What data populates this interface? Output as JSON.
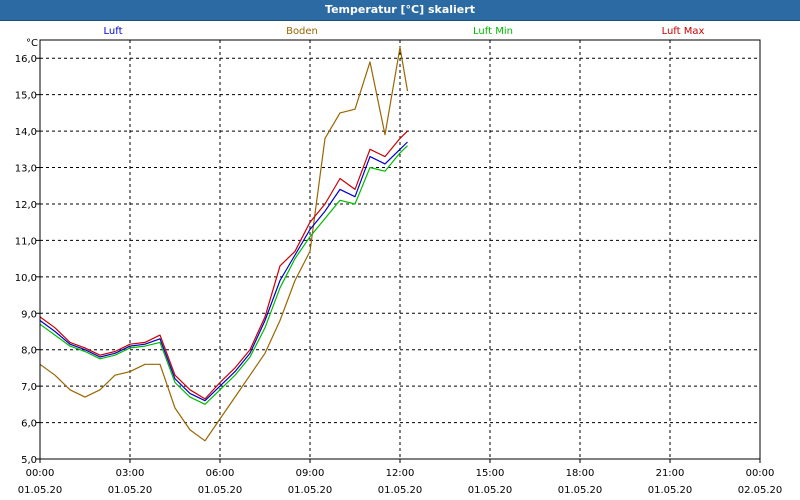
{
  "window": {
    "title": "Temperatur [°C] skaliert"
  },
  "chart_data": {
    "type": "line",
    "title": "Temperatur [°C] skaliert",
    "ylabel": "°C",
    "xlabel": "",
    "ylim": [
      5.0,
      16.5
    ],
    "y_ticks": [
      "5,0",
      "6,0",
      "7,0",
      "8,0",
      "9,0",
      "10,0",
      "11,0",
      "12,0",
      "13,0",
      "14,0",
      "15,0",
      "16,0"
    ],
    "x_ticks": [
      {
        "time": "00:00",
        "date": "01.05.20"
      },
      {
        "time": "03:00",
        "date": "01.05.20"
      },
      {
        "time": "06:00",
        "date": "01.05.20"
      },
      {
        "time": "09:00",
        "date": "01.05.20"
      },
      {
        "time": "12:00",
        "date": "01.05.20"
      },
      {
        "time": "15:00",
        "date": "01.05.20"
      },
      {
        "time": "18:00",
        "date": "01.05.20"
      },
      {
        "time": "21:00",
        "date": "01.05.20"
      },
      {
        "time": "00:00",
        "date": "02.05.20"
      }
    ],
    "xlim_hours": [
      0,
      24
    ],
    "grid": true,
    "legend_position": "top",
    "series": [
      {
        "name": "Luft",
        "color": "#0000cc",
        "x": [
          0,
          0.5,
          1,
          1.5,
          2,
          2.5,
          3,
          3.5,
          4,
          4.5,
          5,
          5.5,
          6,
          6.5,
          7,
          7.5,
          8,
          8.5,
          9,
          9.5,
          10,
          10.5,
          11,
          11.5,
          12,
          12.25
        ],
        "y": [
          8.8,
          8.5,
          8.15,
          8.0,
          7.8,
          7.9,
          8.1,
          8.15,
          8.3,
          7.2,
          6.8,
          6.6,
          7.0,
          7.4,
          7.9,
          8.8,
          9.9,
          10.6,
          11.3,
          11.8,
          12.4,
          12.2,
          13.3,
          13.1,
          13.5,
          13.7
        ]
      },
      {
        "name": "Boden",
        "color": "#996600",
        "x": [
          0,
          0.5,
          1,
          1.5,
          2,
          2.5,
          3,
          3.5,
          4,
          4.5,
          5,
          5.5,
          6,
          6.5,
          7,
          7.5,
          8,
          8.5,
          9,
          9.5,
          10,
          10.5,
          11,
          11.5,
          12,
          12.25
        ],
        "y": [
          7.6,
          7.3,
          6.9,
          6.7,
          6.9,
          7.3,
          7.4,
          7.6,
          7.6,
          6.4,
          5.8,
          5.5,
          6.1,
          6.7,
          7.3,
          7.9,
          8.8,
          9.9,
          10.7,
          13.8,
          14.5,
          14.6,
          15.9,
          13.9,
          16.3,
          15.1
        ]
      },
      {
        "name": "Luft Min",
        "color": "#00bb00",
        "x": [
          0,
          0.5,
          1,
          1.5,
          2,
          2.5,
          3,
          3.5,
          4,
          4.5,
          5,
          5.5,
          6,
          6.5,
          7,
          7.5,
          8,
          8.5,
          9,
          9.5,
          10,
          10.5,
          11,
          11.5,
          12,
          12.25
        ],
        "y": [
          8.7,
          8.4,
          8.1,
          7.95,
          7.75,
          7.85,
          8.05,
          8.1,
          8.2,
          7.1,
          6.7,
          6.5,
          6.9,
          7.3,
          7.8,
          8.6,
          9.7,
          10.5,
          11.1,
          11.6,
          12.1,
          12.0,
          13.0,
          12.9,
          13.4,
          13.6
        ]
      },
      {
        "name": "Luft Max",
        "color": "#cc0000",
        "x": [
          0,
          0.5,
          1,
          1.5,
          2,
          2.5,
          3,
          3.5,
          4,
          4.5,
          5,
          5.5,
          6,
          6.5,
          7,
          7.5,
          8,
          8.5,
          9,
          9.5,
          10,
          10.5,
          11,
          11.5,
          12,
          12.25
        ],
        "y": [
          8.9,
          8.6,
          8.2,
          8.05,
          7.85,
          7.95,
          8.15,
          8.2,
          8.4,
          7.3,
          6.9,
          6.65,
          7.1,
          7.5,
          8.0,
          8.9,
          10.3,
          10.7,
          11.5,
          12.0,
          12.7,
          12.4,
          13.5,
          13.3,
          13.8,
          14.0
        ]
      }
    ]
  }
}
